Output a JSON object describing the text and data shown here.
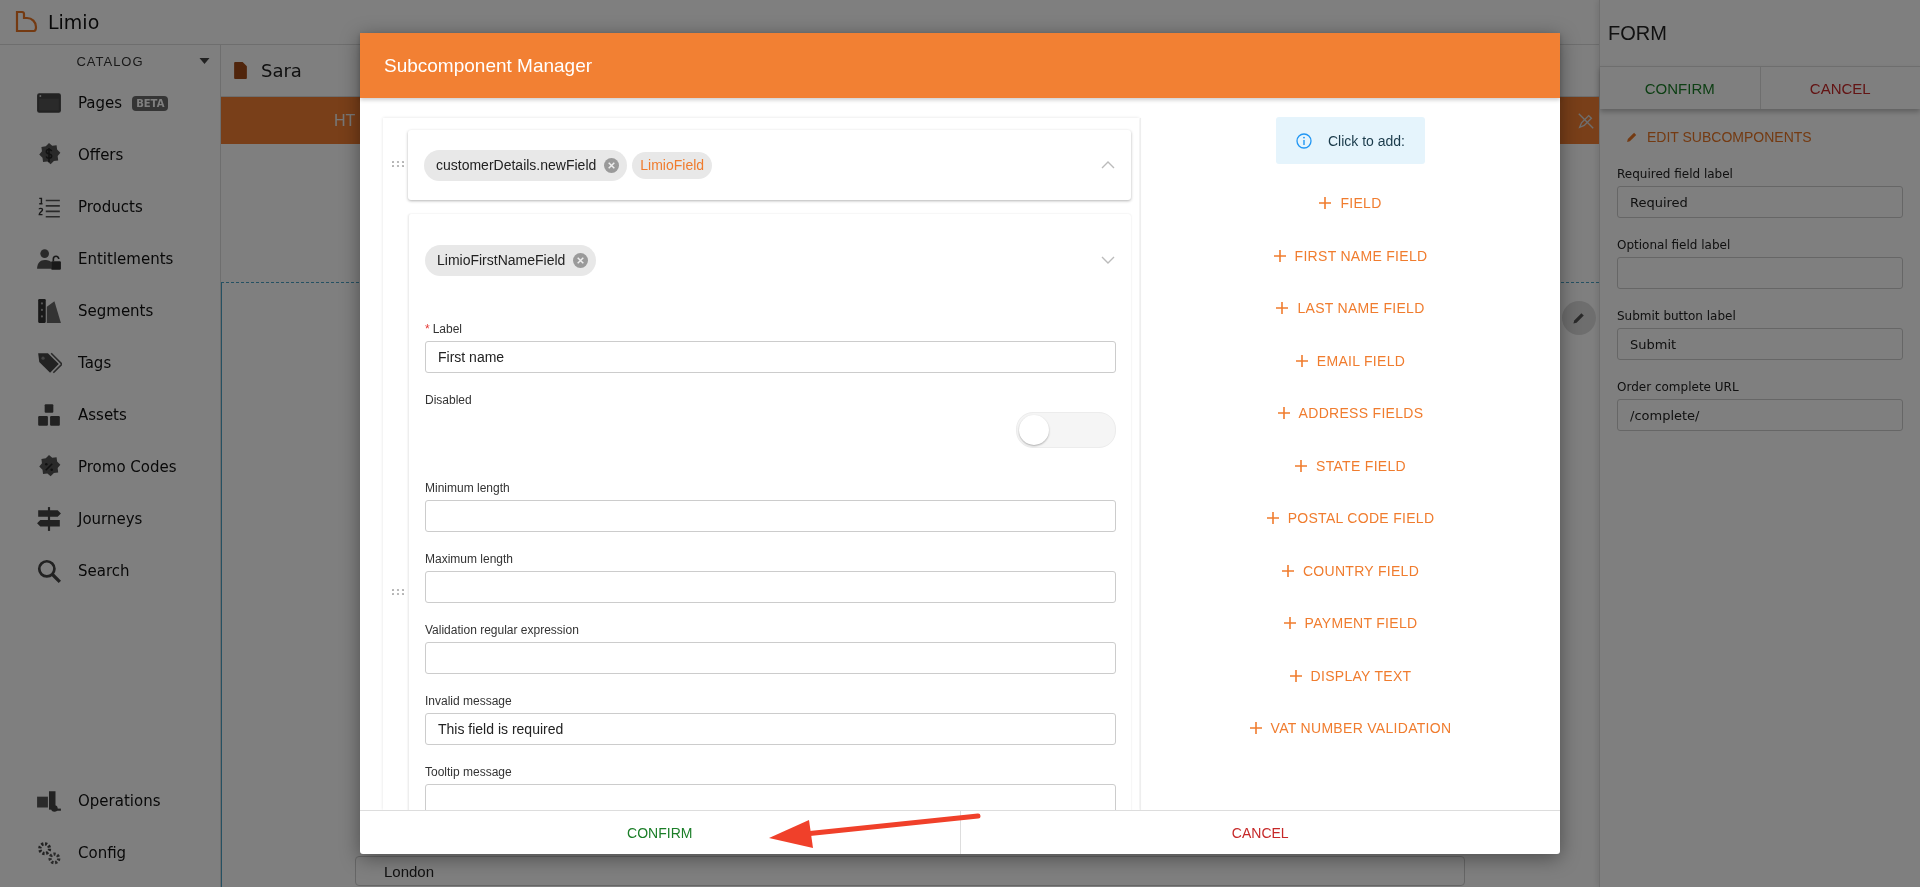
{
  "app": {
    "logo": "Limio"
  },
  "sidebar": {
    "section": "CATALOG",
    "items": [
      {
        "label": "Pages",
        "badge": "BETA"
      },
      {
        "label": "Offers"
      },
      {
        "label": "Products"
      },
      {
        "label": "Entitlements"
      },
      {
        "label": "Segments"
      },
      {
        "label": "Tags"
      },
      {
        "label": "Assets"
      },
      {
        "label": "Promo Codes"
      },
      {
        "label": "Journeys"
      },
      {
        "label": "Search"
      }
    ],
    "bottom_items": [
      {
        "label": "Operations"
      },
      {
        "label": "Config"
      }
    ]
  },
  "page": {
    "title": "Sara",
    "banner": "HT",
    "field_value": "London"
  },
  "form_panel": {
    "title": "FORM",
    "confirm": "CONFIRM",
    "cancel": "CANCEL",
    "edit": "EDIT SUBCOMPONENTS",
    "fields": [
      {
        "label": "Required field label",
        "value": "Required"
      },
      {
        "label": "Optional field label"
      },
      {
        "label": "Submit button label",
        "value": "Submit"
      },
      {
        "label": "Order complete URL",
        "value": "/complete/"
      }
    ]
  },
  "modal": {
    "title": "Subcomponent Manager",
    "required_mark": "*",
    "components": [
      {
        "expanded": false,
        "chips": [
          {
            "text": "customerDetails.newField",
            "kind": "name"
          },
          {
            "text": "LimioField",
            "kind": "type"
          }
        ]
      },
      {
        "expanded": true,
        "chips": [
          {
            "text": "LimioFirstNameField",
            "kind": "name"
          }
        ],
        "fields": [
          {
            "kind": "text",
            "label": "Label",
            "required": true,
            "value": "First name"
          },
          {
            "kind": "toggle",
            "label": "Disabled",
            "required": false,
            "on": false
          },
          {
            "kind": "text",
            "label": "Minimum length",
            "required": false
          },
          {
            "kind": "text",
            "label": "Maximum length",
            "required": false
          },
          {
            "kind": "text",
            "label": "Validation regular expression",
            "required": false
          },
          {
            "kind": "text",
            "label": "Invalid message",
            "required": false,
            "value": "This field is required"
          },
          {
            "kind": "text",
            "label": "Tooltip message",
            "required": false
          }
        ]
      }
    ],
    "add": {
      "hint": "Click to add:",
      "items": [
        "FIELD",
        "FIRST NAME FIELD",
        "LAST NAME FIELD",
        "EMAIL FIELD",
        "ADDRESS FIELDS",
        "STATE FIELD",
        "POSTAL CODE FIELD",
        "COUNTRY FIELD",
        "PAYMENT FIELD",
        "DISPLAY TEXT",
        "VAT NUMBER VALIDATION"
      ]
    },
    "confirm": "CONFIRM",
    "cancel": "CANCEL"
  }
}
